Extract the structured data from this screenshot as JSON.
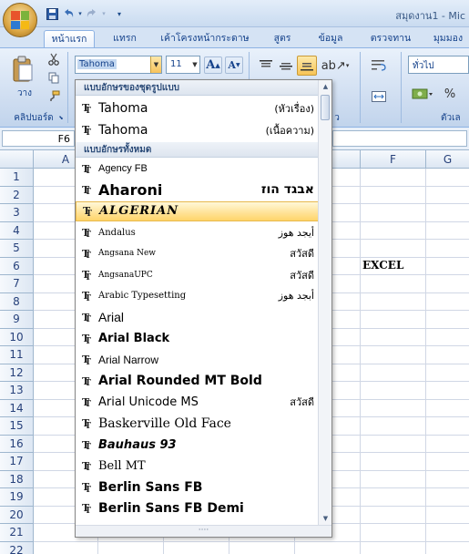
{
  "window": {
    "title": "สมุดงาน1 - Mic"
  },
  "quick_access": {
    "save_icon": "save-icon",
    "undo_icon": "undo-icon",
    "redo_icon": "redo-icon"
  },
  "tabs": [
    {
      "label": "หน้าแรก",
      "active": true
    },
    {
      "label": "แทรก",
      "active": false
    },
    {
      "label": "เค้าโครงหน้ากระดาษ",
      "active": false
    },
    {
      "label": "สูตร",
      "active": false
    },
    {
      "label": "ข้อมูล",
      "active": false
    },
    {
      "label": "ตรวจทาน",
      "active": false
    },
    {
      "label": "มุมมอง",
      "active": false
    }
  ],
  "ribbon": {
    "paste_label": "วาง",
    "clipboard_label": "คลิปบอร์ด",
    "font_name": "Tahoma",
    "font_size": "11",
    "number_format": "ทั่วไป",
    "percent_symbol": "%",
    "number_group_partial": "ตัวเล",
    "alignment_group_partial": "ว"
  },
  "formula_bar": {
    "name_box": "F6",
    "formula": ""
  },
  "grid": {
    "columns": [
      "A",
      "F",
      "G"
    ],
    "rows": [
      "1",
      "2",
      "3",
      "4",
      "5",
      "6",
      "7",
      "8",
      "9",
      "10",
      "11",
      "12",
      "13",
      "14",
      "15",
      "16",
      "17",
      "18",
      "19",
      "20",
      "21",
      "22"
    ],
    "cell_f6": "EXCEL"
  },
  "font_dropdown": {
    "theme_section": "แบบอักษรของชุดรูปแบบ",
    "all_section": "แบบอักษรทั้งหมด",
    "theme_fonts": [
      {
        "name": "Tahoma",
        "sample": "(หัวเรื่อง)"
      },
      {
        "name": "Tahoma",
        "sample": "(เนื้อความ)"
      }
    ],
    "all_fonts": [
      {
        "name": "Agency FB",
        "sample": ""
      },
      {
        "name": "Aharoni",
        "sample": "אבגד הוז"
      },
      {
        "name": "ALGERIAN",
        "sample": "",
        "highlighted": true
      },
      {
        "name": "Andalus",
        "sample": "أيجد هوز"
      },
      {
        "name": "Angsana New",
        "sample": "สวัสดี"
      },
      {
        "name": "AngsanaUPC",
        "sample": "สวัสดี"
      },
      {
        "name": "Arabic Typesetting",
        "sample": "أبجد هوز"
      },
      {
        "name": "Arial",
        "sample": ""
      },
      {
        "name": "Arial Black",
        "sample": ""
      },
      {
        "name": "Arial Narrow",
        "sample": ""
      },
      {
        "name": "Arial Rounded MT Bold",
        "sample": ""
      },
      {
        "name": "Arial Unicode MS",
        "sample": "สวัสดี"
      },
      {
        "name": "Baskerville Old Face",
        "sample": ""
      },
      {
        "name": "Bauhaus 93",
        "sample": ""
      },
      {
        "name": "Bell MT",
        "sample": ""
      },
      {
        "name": "Berlin Sans FB",
        "sample": ""
      },
      {
        "name": "Berlin Sans FB Demi",
        "sample": ""
      }
    ],
    "grip": "····"
  }
}
